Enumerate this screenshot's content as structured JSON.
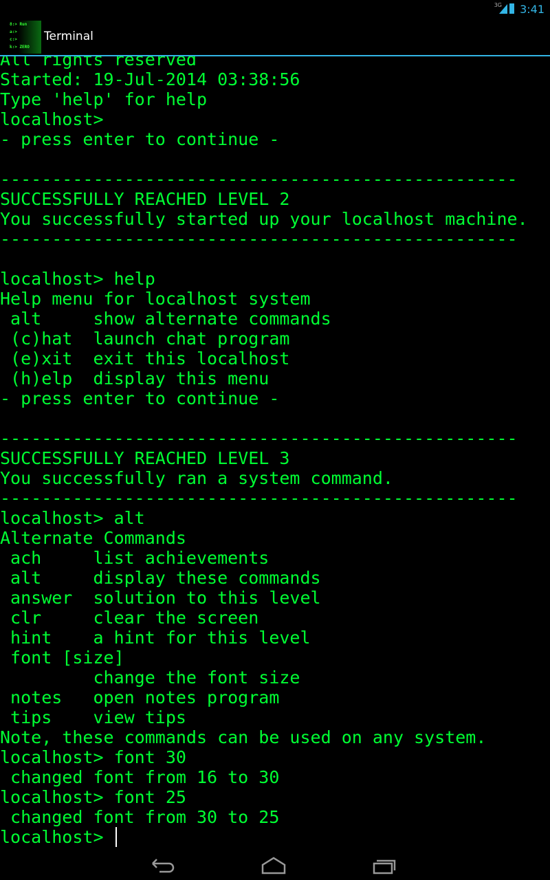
{
  "status_bar": {
    "time": "3:41",
    "network": "3G",
    "icons": [
      "signal-icon",
      "battery-charging-icon"
    ]
  },
  "action_bar": {
    "title": "Terminal",
    "app_icon_text": [
      "8:> Run",
      "a:>",
      "c:>",
      "k:> ZERO"
    ]
  },
  "terminal": {
    "lines": [
      "All rights reserved",
      "Started: 19-Jul-2014 03:38:56",
      "Type 'help' for help",
      "localhost>",
      "- press enter to continue -",
      "",
      "--------------------------------------------------",
      "SUCCESSFULLY REACHED LEVEL 2",
      "You successfully started up your localhost machine.",
      "--------------------------------------------------",
      "",
      "localhost> help",
      "Help menu for localhost system",
      " alt     show alternate commands",
      " (c)hat  launch chat program",
      " (e)xit  exit this localhost",
      " (h)elp  display this menu",
      "- press enter to continue -",
      "",
      "--------------------------------------------------",
      "SUCCESSFULLY REACHED LEVEL 3",
      "You successfully ran a system command.",
      "--------------------------------------------------",
      "localhost> alt",
      "Alternate Commands",
      " ach     list achievements",
      " alt     display these commands",
      " answer  solution to this level",
      " clr     clear the screen",
      " hint    a hint for this level",
      " font [size]",
      "         change the font size",
      " notes   open notes program",
      " tips    view tips",
      "Note, these commands can be used on any system.",
      "localhost> font 30",
      " changed font from 16 to 30",
      "localhost> font 25",
      " changed font from 30 to 25"
    ],
    "prompt": "localhost> ",
    "text_color": "#00ff33"
  },
  "nav_bar": {
    "buttons": [
      "back-icon",
      "home-icon",
      "recents-icon"
    ]
  }
}
